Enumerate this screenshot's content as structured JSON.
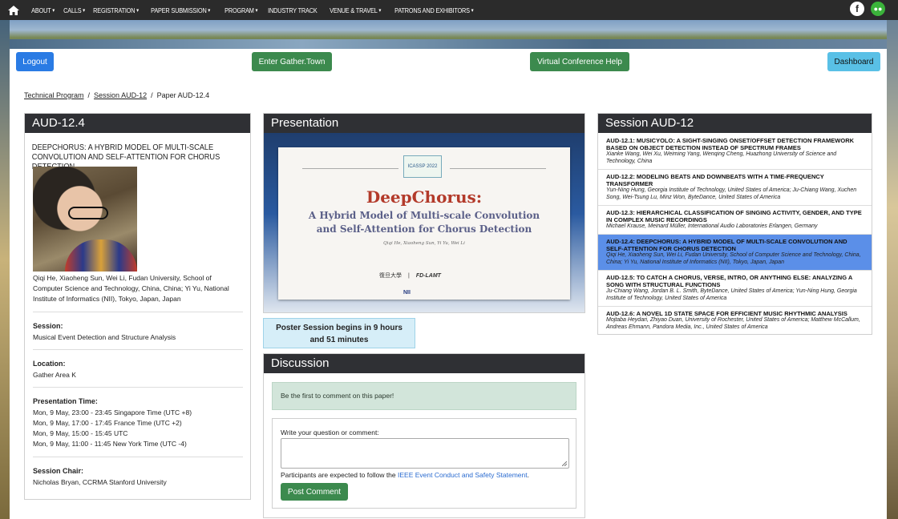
{
  "nav": {
    "items": [
      {
        "label": "About",
        "dropdown": true
      },
      {
        "label": "Calls",
        "dropdown": true
      },
      {
        "label": "Registration",
        "dropdown": true
      },
      {
        "label": "Paper Submission",
        "dropdown": true
      },
      {
        "label": "Program",
        "dropdown": true
      },
      {
        "label": "Industry Track",
        "dropdown": false
      },
      {
        "label": "Venue & Travel",
        "dropdown": true
      },
      {
        "label": "Patrons and Exhibitors",
        "dropdown": true
      }
    ],
    "social": [
      "facebook-icon",
      "wechat-icon"
    ]
  },
  "actions": {
    "logout": "Logout",
    "gather": "Enter Gather.Town",
    "help": "Virtual Conference Help",
    "dashboard": "Dashboard"
  },
  "breadcrumb": {
    "b1": "Technical Program",
    "b2": "Session AUD-12",
    "b3": "Paper AUD-12.4",
    "sep": "/"
  },
  "paper": {
    "id": "AUD-12.4",
    "title": "DeepChorus: A Hybrid Model of Multi-scale Convolution and Self-attention for Chorus Detection",
    "authors": "Qiqi He, Xiaoheng Sun, Wei Li, Fudan University, School of Computer Science and Technology, China, China; Yi Yu, National Institute of Informatics (NII), Tokyo, Japan, Japan",
    "session_label": "Session:",
    "session": "Musical Event Detection and Structure Analysis",
    "location_label": "Location:",
    "location": "Gather Area K",
    "time_label": "Presentation Time:",
    "time1": "Mon, 9 May, 23:00 - 23:45 Singapore Time (UTC +8)",
    "time2": "Mon, 9 May, 17:00 - 17:45 France Time (UTC +2)",
    "time3": "Mon, 9 May, 15:00 - 15:45 UTC",
    "time4": "Mon, 9 May, 11:00 - 11:45 New York Time (UTC -4)",
    "chair_label": "Session Chair:",
    "chair": "Nicholas Bryan, CCRMA Stanford University"
  },
  "presentation": {
    "header": "Presentation",
    "slide_logo": "ICASSP 2022",
    "slide_title": "DeepChorus:",
    "slide_sub1": "A Hybrid Model of Multi-scale Convolution",
    "slide_sub2": "and Self-Attention for Chorus Detection",
    "slide_authors": "Qiqi He, Xiaoheng Sun, Yi Yu, Wei Li",
    "slide_logo_left": "復旦大學",
    "slide_logo_right": "FD-LAMT",
    "slide_logo_nii": "NII"
  },
  "poster": {
    "line1": "Poster Session begins in 9 hours",
    "line2": "and 51 minutes"
  },
  "discussion": {
    "header": "Discussion",
    "first": "Be the first to comment on this paper!",
    "label": "Write your question or comment:",
    "note_prefix": "Participants are expected to follow the ",
    "note_link": "IEEE Event Conduct and Safety Statement",
    "note_suffix": ".",
    "post": "Post Comment"
  },
  "session": {
    "header": "Session AUD-12",
    "items": [
      {
        "title": "AUD-12.1: MUSICYOLO: A SIGHT-SINGING ONSET/OFFSET DETECTION FRAMEWORK BASED ON OBJECT DETECTION INSTEAD OF SPECTRUM FRAMES",
        "authors": "Xianke Wang, Wei Xu, Weiming Yang, Wenqing Cheng, Huazhong University of Science and Technology, China"
      },
      {
        "title": "AUD-12.2: MODELING BEATS AND DOWNBEATS WITH A TIME-FREQUENCY TRANSFORMER",
        "authors": "Yun-Ning Hung, Georgia Institute of Technology, United States of America; Ju-Chiang Wang, Xuchen Song, Wei-Tsung Lu, Minz Won, ByteDance, United States of America"
      },
      {
        "title": "AUD-12.3: HIERARCHICAL CLASSIFICATION OF SINGING ACTIVITY, GENDER, AND TYPE IN COMPLEX MUSIC RECORDINGS",
        "authors": "Michael Krause, Meinard Müller, International Audio Laboratories Erlangen, Germany"
      },
      {
        "title": "AUD-12.4: DEEPCHORUS: A HYBRID MODEL OF MULTI-SCALE CONVOLUTION AND SELF-ATTENTION FOR CHORUS DETECTION",
        "authors": "Qiqi He, Xiaoheng Sun, Wei Li, Fudan University, School of Computer Science and Technology, China, China; Yi Yu, National Institute of Informatics (NII), Tokyo, Japan, Japan"
      },
      {
        "title": "AUD-12.5: TO CATCH A CHORUS, VERSE, INTRO, OR ANYTHING ELSE: ANALYZING A SONG WITH STRUCTURAL FUNCTIONS",
        "authors": "Ju-Chiang Wang, Jordan B. L. Smith, ByteDance, United States of America; Yun-Ning Hung, Georgia Institute of Technology, United States of America"
      },
      {
        "title": "AUD-12.6: A NOVEL 1D STATE SPACE FOR EFFICIENT MUSIC RHYTHMIC ANALYSIS",
        "authors": "Mojtaba Heydari, Zhiyao Duan, University of Rochester, United States of America; Matthew McCallum, Andreas Ehmann, Pandora Media, Inc., United States of America"
      }
    ]
  }
}
